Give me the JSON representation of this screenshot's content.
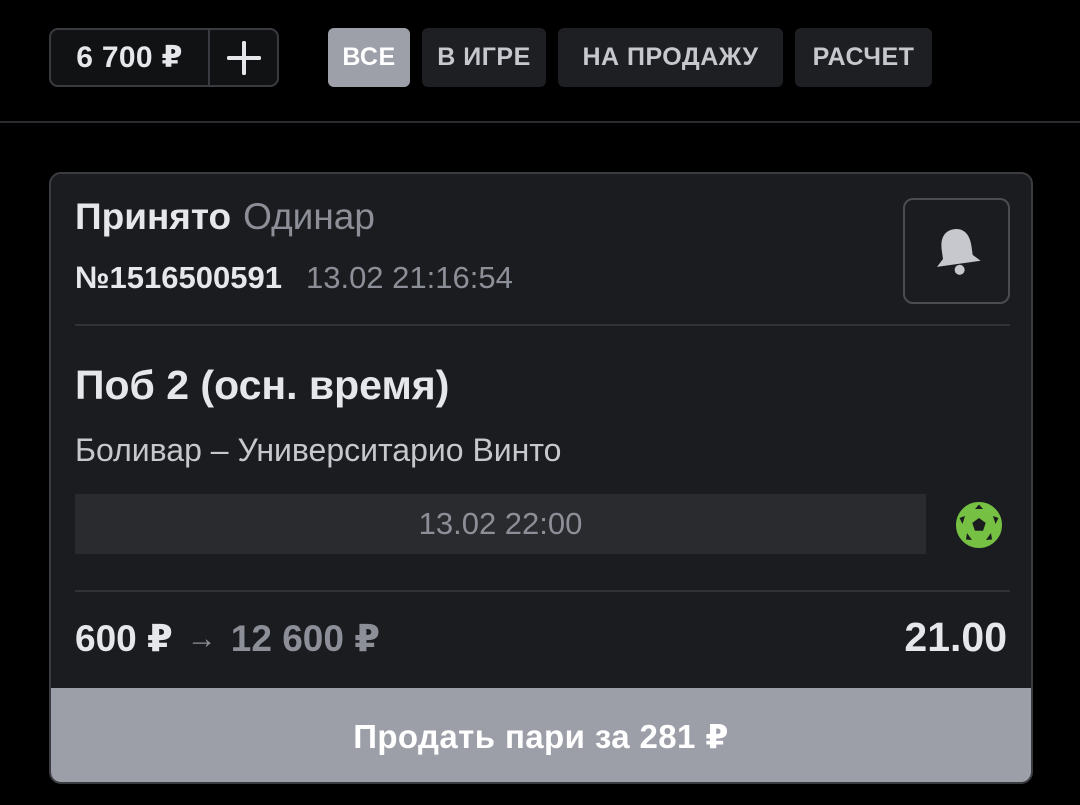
{
  "header": {
    "balance": "6 700 ₽",
    "add_icon": "plus-icon",
    "filters": [
      {
        "label": "ВСЕ",
        "active": true
      },
      {
        "label": "В ИГРЕ",
        "active": false
      },
      {
        "label": "НА ПРОДАЖУ",
        "active": false
      },
      {
        "label": "РАСЧЕТ",
        "active": false
      }
    ]
  },
  "bet": {
    "status": "Принято",
    "type": "Одинар",
    "number": "№1516500591",
    "placed_at": "13.02 21:16:54",
    "notify_icon": "bell-icon",
    "market": "Поб 2 (осн. время)",
    "event": "Боливар – Университарио Винто",
    "event_start": "13.02 22:00",
    "sport_icon": "football-icon",
    "stake": "600 ₽",
    "arrow": "→",
    "potential_payout": "12 600 ₽",
    "odds": "21.00",
    "sell_label": "Продать пари за 281 ₽"
  },
  "colors": {
    "background": "#000000",
    "card": "#1b1c1f",
    "active_filter": "#9d9fa9",
    "sell_button": "#9c9ea8",
    "sport_icon": "#76c043",
    "muted_text": "#8d8f98"
  }
}
